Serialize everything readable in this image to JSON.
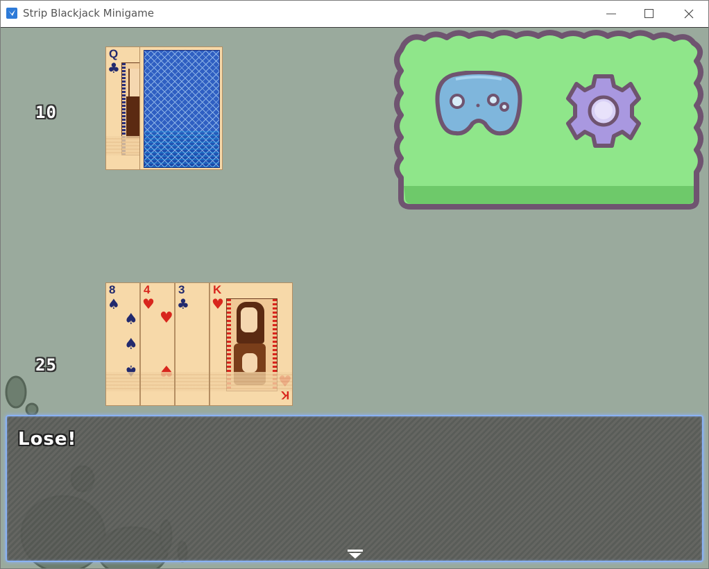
{
  "window": {
    "title": "Strip Blackjack Minigame",
    "controls": [
      "minimize",
      "maximize",
      "close"
    ]
  },
  "dealer": {
    "score": "10",
    "cards": [
      {
        "rank": "Q",
        "suit": "clubs",
        "suit_glyph": "♣",
        "color": "blue",
        "face_up": true
      },
      {
        "face_up": false
      }
    ]
  },
  "player": {
    "score": "25",
    "cards": [
      {
        "rank": "8",
        "suit": "spades",
        "suit_glyph": "♠",
        "color": "blue"
      },
      {
        "rank": "4",
        "suit": "hearts",
        "suit_glyph": "♥",
        "color": "red"
      },
      {
        "rank": "3",
        "suit": "clubs",
        "suit_glyph": "♣",
        "color": "blue"
      },
      {
        "rank": "K",
        "suit": "hearts",
        "suit_glyph": "♥",
        "color": "red"
      }
    ]
  },
  "menu": {
    "icons": [
      "gamepad-icon",
      "gear-icon"
    ],
    "panel_color": "#8fe68a",
    "border_color": "#6f5470"
  },
  "message": {
    "text": "Lose!"
  },
  "colors": {
    "background": "#9aaa9d",
    "card_face": "#f7d9a9",
    "card_back": "#2f5fc2",
    "message_box_border": "#8ab2f4"
  }
}
